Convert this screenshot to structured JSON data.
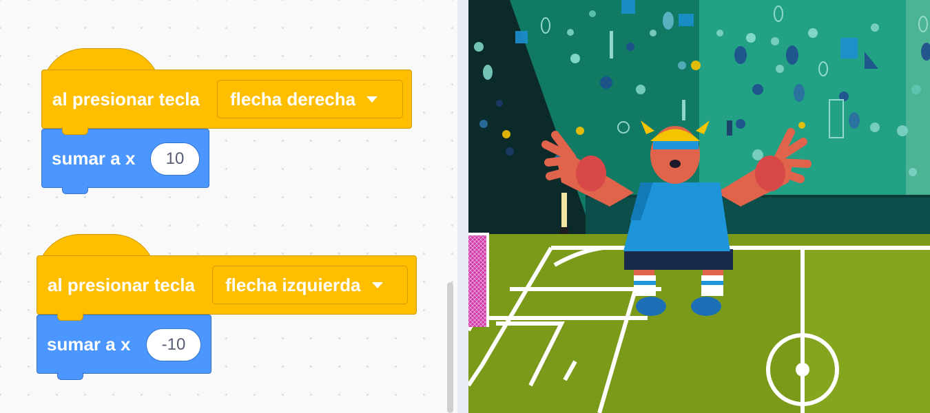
{
  "scripts": [
    {
      "hat_label": "al presionar tecla",
      "key": "flecha derecha",
      "motion_label": "sumar a x",
      "value": "10"
    },
    {
      "hat_label": "al presionar tecla",
      "key": "flecha izquierda",
      "motion_label": "sumar a x",
      "value": "-10"
    }
  ],
  "colors": {
    "events": "#ffbf00",
    "motion": "#4c97ff",
    "field": "#7b9a19",
    "stands": "#0f8a6e",
    "shirt": "#1d95d8"
  },
  "stage": {
    "sprite": "goalkeeper-character",
    "backdrop": "soccer-stadium"
  }
}
